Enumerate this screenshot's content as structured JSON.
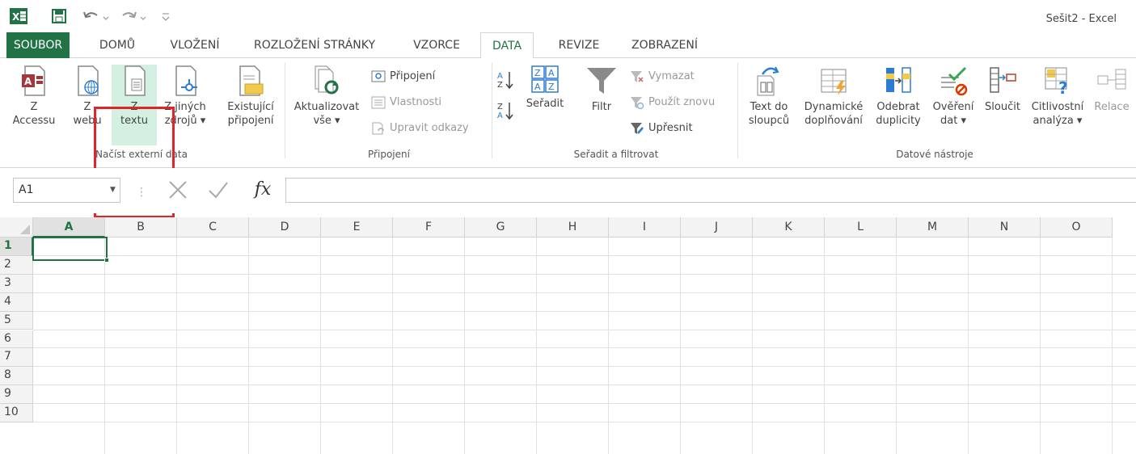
{
  "window": {
    "title": "Sešit2 - Excel"
  },
  "tabs": {
    "file": "SOUBOR",
    "home": "DOMŮ",
    "insert": "VLOŽENÍ",
    "layout": "ROZLOŽENÍ STRÁNKY",
    "formulas": "VZORCE",
    "data": "DATA",
    "review": "REVIZE",
    "view": "ZOBRAZENÍ"
  },
  "ribbon": {
    "external": {
      "access_l1": "Z",
      "access_l2": "Accessu",
      "web_l1": "Z",
      "web_l2": "webu",
      "text_l1": "Z",
      "text_l2": "textu",
      "other_l1": "Z jiných",
      "other_l2": "zdrojů ▾",
      "group": "Načíst externí data"
    },
    "existing": {
      "l1": "Existující",
      "l2": "připojení"
    },
    "connections": {
      "refresh_l1": "Aktualizovat",
      "refresh_l2": "vše ▾",
      "connections": "Připojení",
      "properties": "Vlastnosti",
      "edit_links": "Upravit odkazy",
      "group": "Připojení"
    },
    "sort": {
      "sort": "Seřadit",
      "filter": "Filtr",
      "clear": "Vymazat",
      "reapply": "Použít znovu",
      "advanced": "Upřesnit",
      "group": "Seřadit a filtrovat"
    },
    "tools": {
      "t2c_l1": "Text do",
      "t2c_l2": "sloupců",
      "flash_l1": "Dynamické",
      "flash_l2": "doplňování",
      "dup_l1": "Odebrat",
      "dup_l2": "duplicity",
      "valid_l1": "Ověření",
      "valid_l2": "dat ▾",
      "consol": "Sloučit",
      "whatif_l1": "Citlivostní",
      "whatif_l2": "analýza ▾",
      "rel": "Relace",
      "group": "Datové nástroje"
    }
  },
  "formula_bar": {
    "name_box": "A1",
    "fx": "fx",
    "formula": ""
  },
  "grid": {
    "columns": [
      "A",
      "B",
      "C",
      "D",
      "E",
      "F",
      "G",
      "H",
      "I",
      "J",
      "K",
      "L",
      "M",
      "N",
      "O"
    ],
    "rows": [
      "1",
      "2",
      "3",
      "4",
      "5",
      "6",
      "7",
      "8",
      "9",
      "10"
    ],
    "active_cell": "A1"
  },
  "colors": {
    "accent": "#217346",
    "highlight": "#e0252a"
  }
}
